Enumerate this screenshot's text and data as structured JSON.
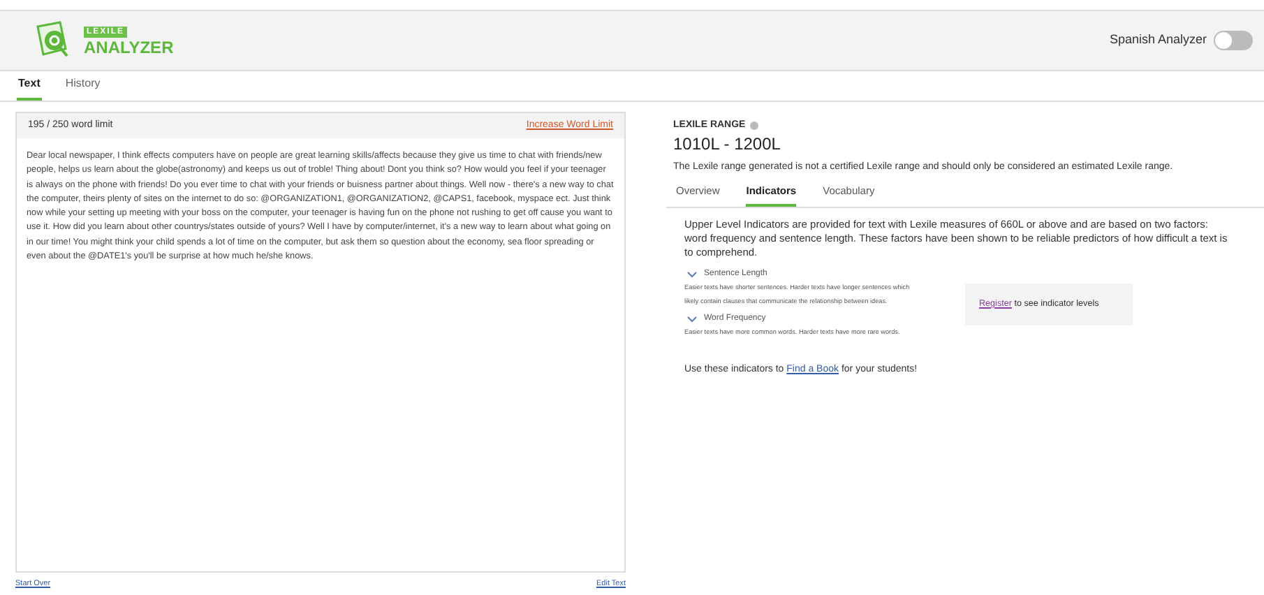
{
  "header": {
    "logo_top": "LEXILE",
    "logo_bottom": "ANALYZER",
    "toggle": {
      "label": "Spanish Analyzer",
      "on": false
    }
  },
  "tabs": [
    {
      "label": "Text",
      "selected": true
    },
    {
      "label": "History",
      "selected": false
    }
  ],
  "editor": {
    "word_count": "195 / 250 word limit",
    "increase_link": "Increase Word Limit",
    "text": "Dear local newspaper, I think effects computers have on people are great learning skills/affects because they give us time to chat with friends/new people, helps us learn about the globe(astronomy) and keeps us out of troble! Thing about! Dont you think so? How would you feel if your teenager is always on the phone with friends! Do you ever time to chat with your friends or buisness partner about things. Well now - there's a new way to chat the computer, theirs plenty of sites on the internet to do so: @ORGANIZATION1, @ORGANIZATION2, @CAPS1, facebook, myspace ect. Just think now while your setting up meeting with your boss on the computer, your teenager is having fun on the phone not rushing to get off cause you want to use it. How did you learn about other countrys/states outside of yours? Well I have by computer/internet, it's a new way to learn about what going on in our time! You might think your child spends a lot of time on the computer, but ask them so question about the economy, sea floor spreading or even about the @DATE1's you'll be surprise at how much he/she knows.",
    "start_over": "Start Over",
    "edit_text": "Edit Text"
  },
  "result": {
    "heading": "LEXILE RANGE",
    "range": "1010L - 1200L",
    "disclaimer": "The Lexile range generated is not a certified Lexile range and should only be considered an estimated Lexile range.",
    "tabs": [
      {
        "label": "Overview",
        "selected": false
      },
      {
        "label": "Indicators",
        "selected": true
      },
      {
        "label": "Vocabulary",
        "selected": false
      }
    ],
    "intro": "Upper Level Indicators are provided for text with Lexile measures of 660L or above and are based on two factors: word frequency and sentence length. These factors have been shown to be reliable predictors of how difficult a text is to comprehend.",
    "indicators": [
      {
        "title": "Sentence Length",
        "expanded": true,
        "description": "Easier texts have shorter sentences. Harder texts have longer sentences which likely contain clauses that communicate the relationship between ideas."
      },
      {
        "title": "Word Frequency",
        "expanded": true,
        "description": "Easier texts have more common words. Harder texts have more rare words."
      }
    ],
    "register": {
      "link": "Register",
      "text": "to see indicator levels"
    },
    "footer": {
      "before": "Use these indicators to",
      "link": "Find a Book",
      "after": "for your students!"
    }
  }
}
